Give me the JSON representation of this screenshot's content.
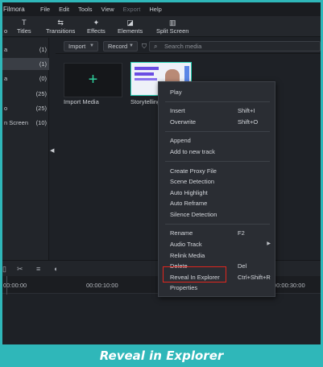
{
  "menubar": {
    "app_name": "Filmora",
    "items": [
      {
        "label": "File",
        "enabled": true
      },
      {
        "label": "Edit",
        "enabled": true
      },
      {
        "label": "Tools",
        "enabled": true
      },
      {
        "label": "View",
        "enabled": true
      },
      {
        "label": "Export",
        "enabled": false
      },
      {
        "label": "Help",
        "enabled": true
      }
    ]
  },
  "toolbar": {
    "partial_label": "o",
    "titles": "Titles",
    "transitions": "Transitions",
    "effects": "Effects",
    "elements": "Elements",
    "split_screen": "Split Screen"
  },
  "library": {
    "rows": [
      {
        "name": "a",
        "count": "(1)",
        "selected": false
      },
      {
        "name": "",
        "count": "(1)",
        "selected": true
      },
      {
        "name": "a",
        "count": "(0)",
        "selected": false
      },
      {
        "name": "",
        "count": "(25)",
        "selected": false
      },
      {
        "name": "o",
        "count": "(25)",
        "selected": false
      },
      {
        "name": "n Screen",
        "count": "(10)",
        "selected": false
      }
    ]
  },
  "media": {
    "import_label": "Import",
    "record_label": "Record",
    "search_placeholder": "Search media",
    "tiles": [
      {
        "label": "Import Media"
      },
      {
        "label": "Storytelling"
      }
    ]
  },
  "timeline": {
    "timecodes": [
      "00:00:00",
      "00:00:10:00",
      "00:00:30:00"
    ]
  },
  "context_menu": {
    "items": [
      {
        "label": "Play",
        "shortcut": ""
      },
      {
        "label": "Insert",
        "shortcut": "Shift+I"
      },
      {
        "label": "Overwrite",
        "shortcut": "Shift+O"
      },
      {
        "label": "Append",
        "shortcut": ""
      },
      {
        "label": "Add to new track",
        "shortcut": ""
      },
      {
        "label": "Create Proxy File",
        "shortcut": ""
      },
      {
        "label": "Scene Detection",
        "shortcut": ""
      },
      {
        "label": "Auto Highlight",
        "shortcut": ""
      },
      {
        "label": "Auto Reframe",
        "shortcut": ""
      },
      {
        "label": "Silence Detection",
        "shortcut": ""
      },
      {
        "label": "Rename",
        "shortcut": "F2"
      },
      {
        "label": "Audio Track",
        "shortcut": ""
      },
      {
        "label": "Relink Media",
        "shortcut": ""
      },
      {
        "label": "Delete",
        "shortcut": "Del"
      },
      {
        "label": "Reveal In Explorer",
        "shortcut": "Ctrl+Shift+R"
      },
      {
        "label": "Properties",
        "shortcut": ""
      }
    ]
  },
  "caption": "Reveal in Explorer",
  "colors": {
    "frame": "#2fb7b9",
    "highlight": "#e0261e",
    "accent_green": "#2fd19e"
  }
}
